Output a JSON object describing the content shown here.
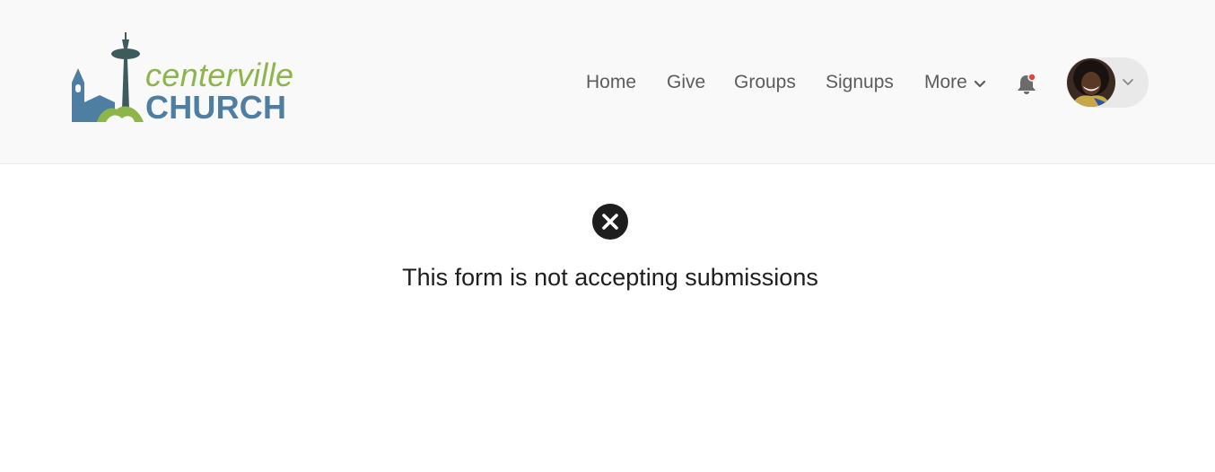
{
  "brand": {
    "name_top": "centerville",
    "name_bottom": "CHURCH",
    "colors": {
      "green": "#8db54a",
      "blue": "#4e7ea2",
      "tower": "#3d5a5c"
    }
  },
  "nav": {
    "items": [
      {
        "label": "Home"
      },
      {
        "label": "Give"
      },
      {
        "label": "Groups"
      },
      {
        "label": "Signups"
      },
      {
        "label": "More"
      }
    ],
    "more_icon": "chevron-down-icon",
    "notifications_icon": "bell-icon",
    "notifications_unread": true,
    "notification_dot_color": "#e0443a"
  },
  "user_menu": {
    "icon": "chevron-down-icon"
  },
  "status": {
    "icon": "close-circle-icon",
    "message": "This form is not accepting submissions"
  }
}
